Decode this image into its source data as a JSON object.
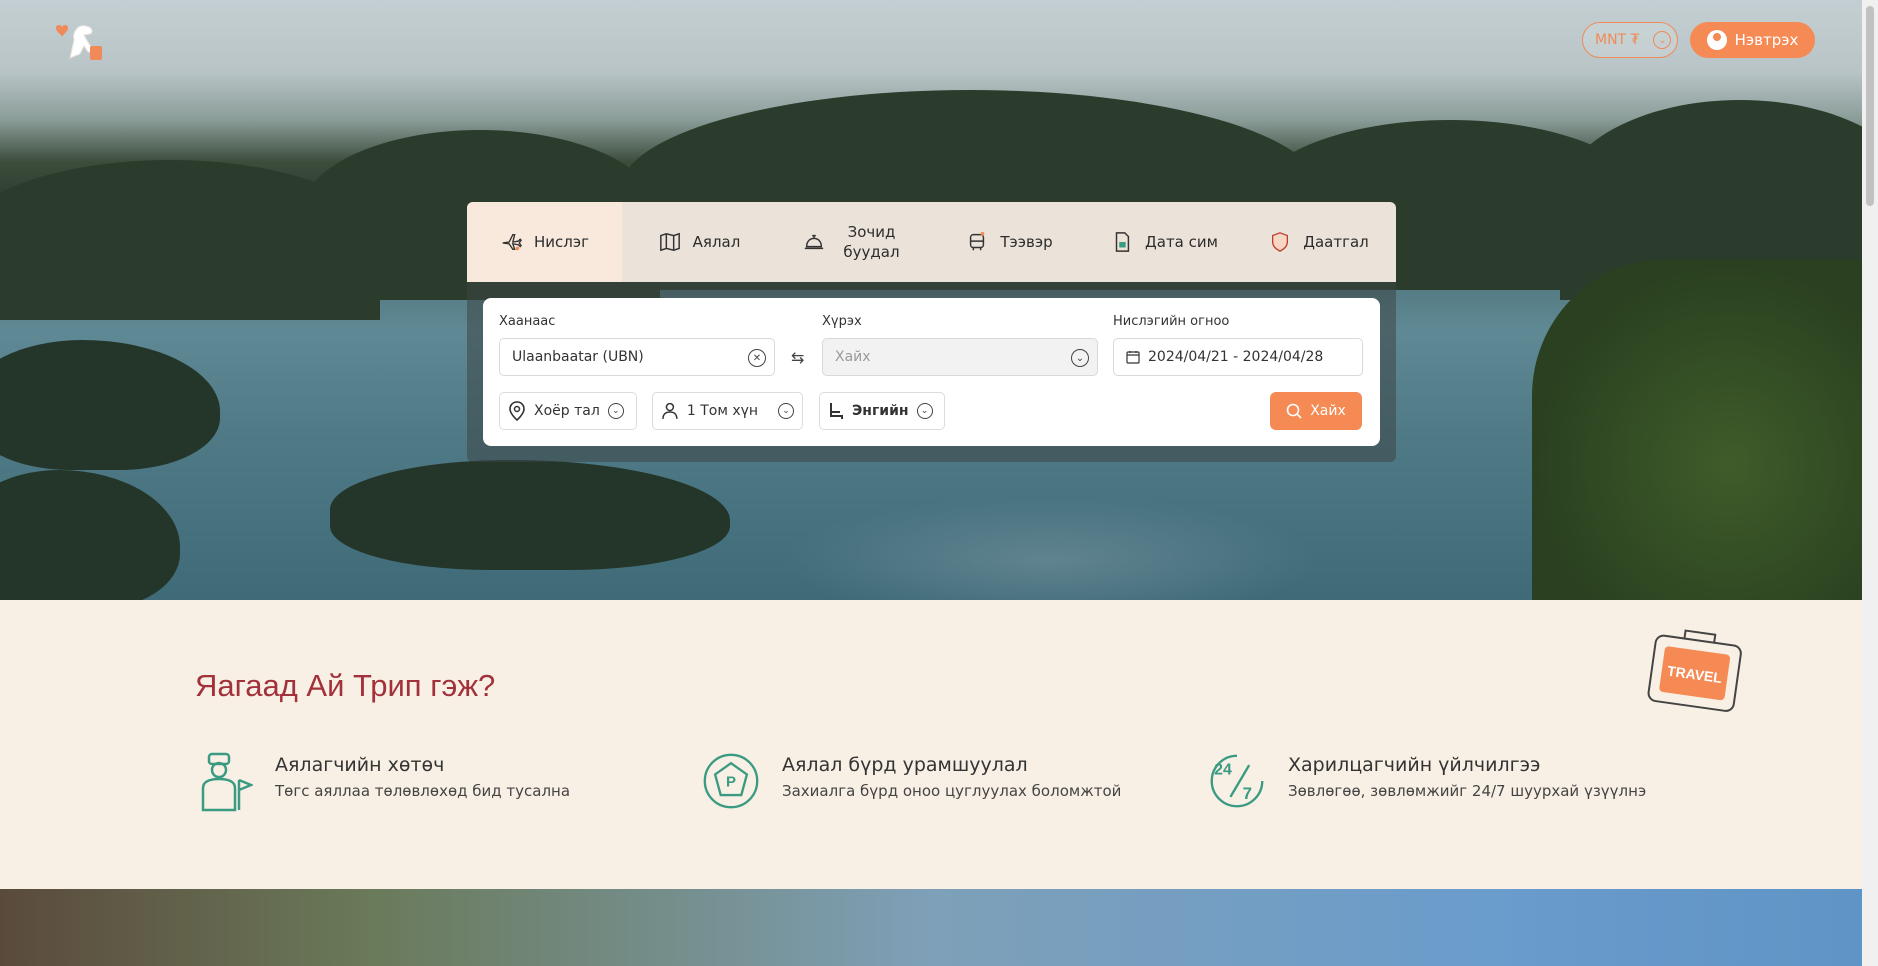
{
  "header": {
    "currency_label": "MNT ₮",
    "login_label": "Нэвтрэх"
  },
  "tabs": [
    {
      "label": "Нислэг",
      "icon": "plane-icon"
    },
    {
      "label": "Аялал",
      "icon": "map-icon"
    },
    {
      "label": "Зочид буудал",
      "icon": "hotel-bell-icon"
    },
    {
      "label": "Тээвэр",
      "icon": "bus-icon"
    },
    {
      "label": "Дата сим",
      "icon": "sim-card-icon"
    },
    {
      "label": "Даатгал",
      "icon": "shield-icon"
    }
  ],
  "search": {
    "from_label": "Хаанаас",
    "from_value": "Ulaanbaatar (UBN)",
    "to_label": "Хүрэх",
    "to_placeholder": "Хайх",
    "date_label": "Нислэгийн огноо",
    "date_value": "2024/04/21 - 2024/04/28",
    "trip_type": "Хоёр тал",
    "passengers": "1 Том хүн",
    "cabin_class": "Энгийн",
    "search_button": "Хайх"
  },
  "why": {
    "title": "Яагаад Ай Трип гэж?",
    "badge_text": "TRAVEL",
    "features": [
      {
        "title": "Аялагчийн хөтөч",
        "desc": "Төгс аяллаа төлөвлөхөд бид тусална",
        "icon": "guide-icon"
      },
      {
        "title": "Аялал бүрд урамшуулал",
        "desc": "Захиалга бүрд оноо цуглуулах боломжтой",
        "icon": "points-icon"
      },
      {
        "title": "Харилцагчийн үйлчилгээ",
        "desc": "Зөвлөгөө, зөвлөмжийг 24/7 шуурхай үзүүлнэ",
        "icon": "support-247-icon"
      }
    ]
  },
  "colors": {
    "accent": "#f58a55",
    "title_red": "#a2313b",
    "icon_green": "#3a9a82"
  }
}
